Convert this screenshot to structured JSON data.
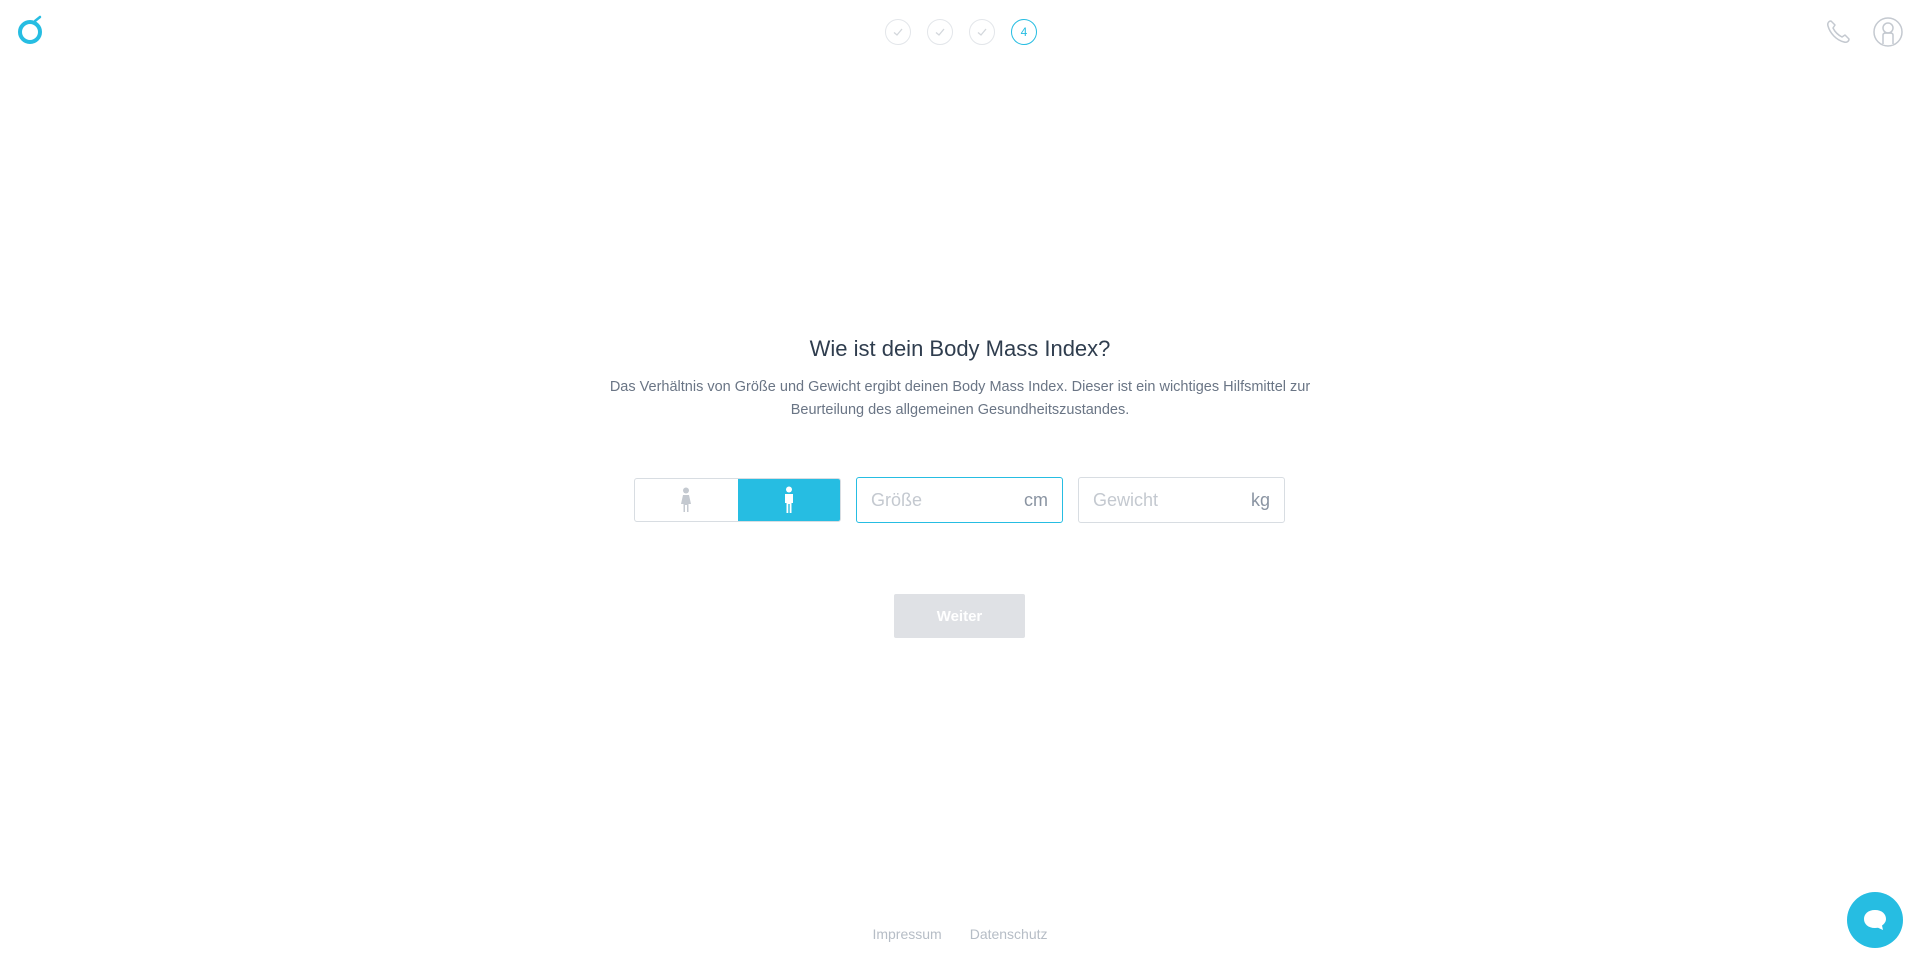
{
  "header": {
    "logo_icon": "ring-logo-icon",
    "steps": [
      {
        "state": "done",
        "icon": "check-icon"
      },
      {
        "state": "done",
        "icon": "check-icon"
      },
      {
        "state": "done",
        "icon": "check-icon"
      },
      {
        "state": "current",
        "label": "4"
      }
    ],
    "icons": [
      "phone-icon",
      "user-icon"
    ]
  },
  "main": {
    "title": "Wie ist dein Body Mass Index?",
    "subtitle": "Das Verhältnis von Größe und Gewicht ergibt deinen Body Mass Index. Dieser ist ein wichtiges Hilfsmittel zur Beurteilung des allgemeinen Gesundheitszustandes.",
    "gender": {
      "options": [
        {
          "icon": "female-figure-icon",
          "selected": false
        },
        {
          "icon": "male-figure-icon",
          "selected": true
        }
      ]
    },
    "height": {
      "placeholder": "Größe",
      "value": "",
      "unit": "cm"
    },
    "weight": {
      "placeholder": "Gewicht",
      "value": "",
      "unit": "kg"
    },
    "next_label": "Weiter"
  },
  "footer": {
    "links": [
      "Impressum",
      "Datenschutz"
    ]
  },
  "colors": {
    "accent": "#26bde2",
    "disabled_button": "#dfe1e5",
    "border": "#d8dde2",
    "text_title": "#2f3d4e",
    "text_body": "#6a7585"
  },
  "chat": {
    "icon": "chat-bubble-icon"
  }
}
